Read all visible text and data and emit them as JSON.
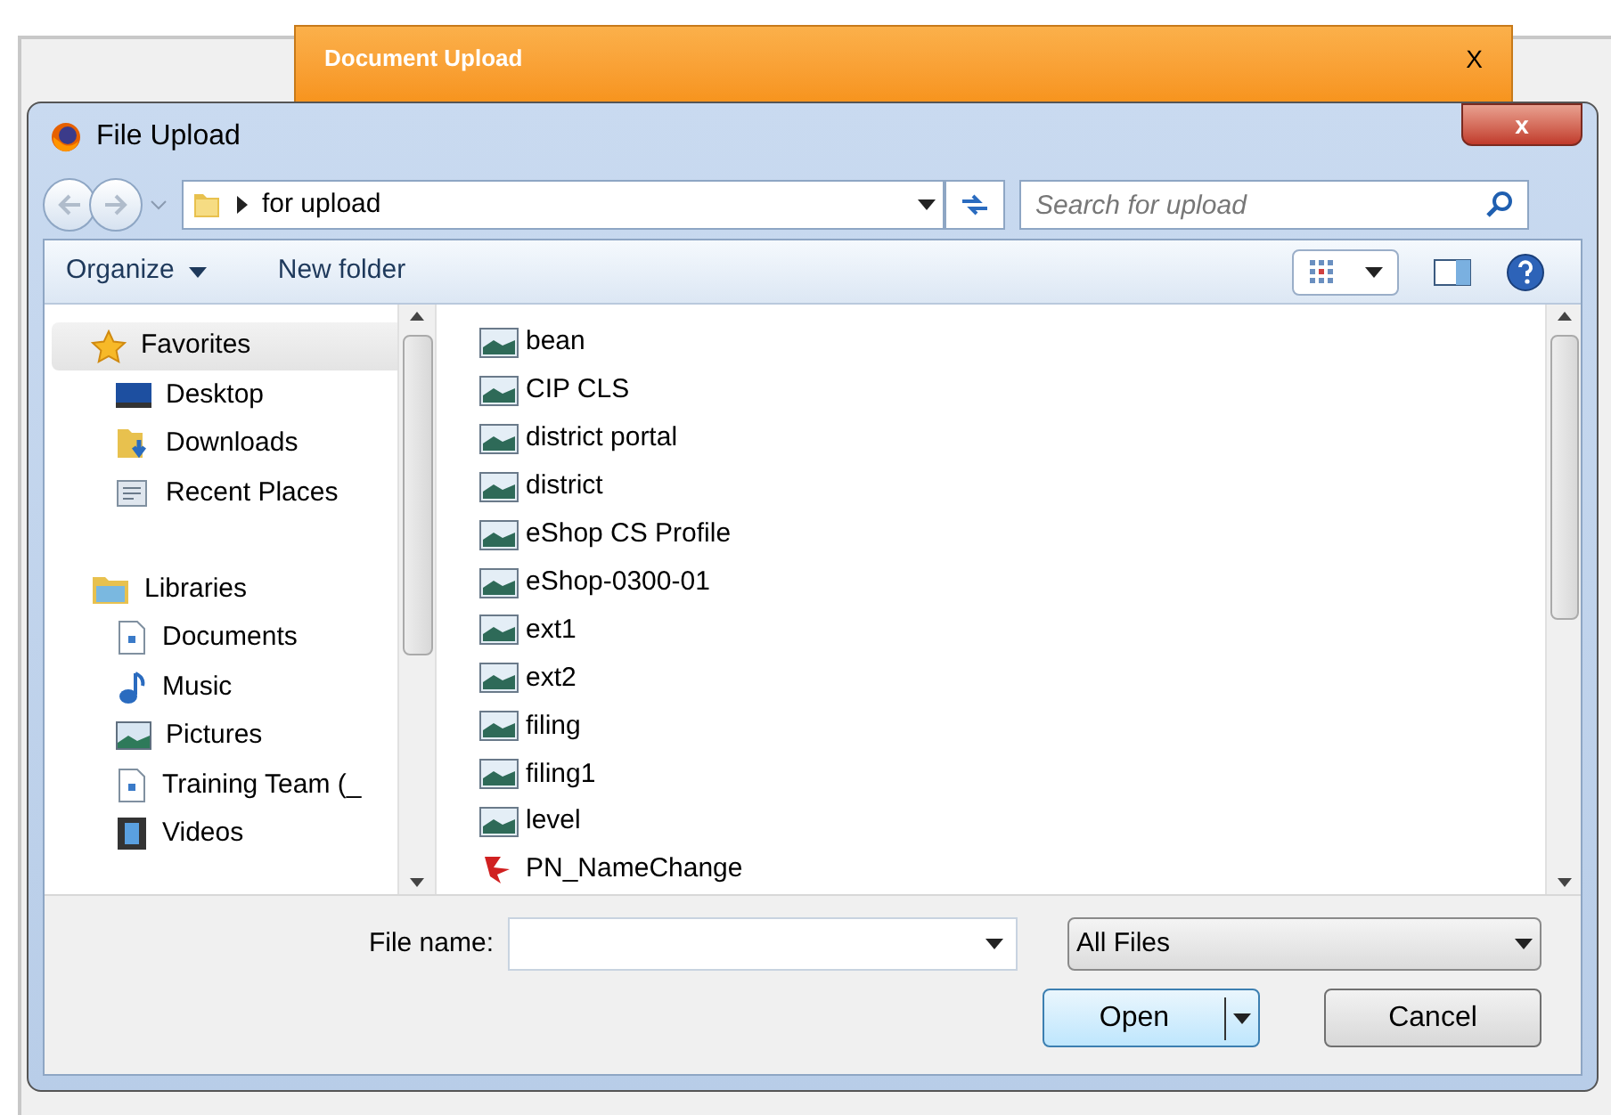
{
  "background_window": {
    "title": "Document Upload",
    "close": "X"
  },
  "window": {
    "title": "File Upload",
    "close": "x"
  },
  "address_bar": {
    "path": "for upload"
  },
  "search": {
    "placeholder": "Search for upload"
  },
  "toolbar": {
    "buttons": [
      "Organize",
      "New folder"
    ]
  },
  "sidebar": {
    "items": [
      {
        "kind": "header",
        "label": "Favorites",
        "selected": true
      },
      {
        "kind": "item",
        "label": "Desktop",
        "selected": false
      },
      {
        "kind": "item",
        "label": "Downloads",
        "selected": false
      },
      {
        "kind": "item",
        "label": "Recent Places",
        "selected": false
      },
      {
        "kind": "gap"
      },
      {
        "kind": "header",
        "label": "Libraries",
        "selected": false
      },
      {
        "kind": "item",
        "label": "Documents",
        "selected": false
      },
      {
        "kind": "item",
        "label": "Music",
        "selected": false
      },
      {
        "kind": "item",
        "label": "Pictures",
        "selected": false
      },
      {
        "kind": "item",
        "label": "Training Team (_",
        "selected": false
      },
      {
        "kind": "item",
        "label": "Videos",
        "selected": false
      }
    ]
  },
  "files": [
    {
      "kind": "image",
      "name": "bean"
    },
    {
      "kind": "image",
      "name": "CIP CLS"
    },
    {
      "kind": "image",
      "name": "district portal"
    },
    {
      "kind": "image",
      "name": "district"
    },
    {
      "kind": "image",
      "name": "eShop CS Profile"
    },
    {
      "kind": "image",
      "name": "eShop-0300-01"
    },
    {
      "kind": "image",
      "name": "ext1"
    },
    {
      "kind": "image",
      "name": "ext2"
    },
    {
      "kind": "image",
      "name": "filing"
    },
    {
      "kind": "image",
      "name": "filing1"
    },
    {
      "kind": "image",
      "name": "level"
    },
    {
      "kind": "pdf",
      "name": "PN_NameChange"
    }
  ],
  "file_name": {
    "label": "File name:"
  },
  "file_type": {
    "value": "All Files"
  },
  "buttons": {
    "open": "Open",
    "cancel": "Cancel"
  }
}
